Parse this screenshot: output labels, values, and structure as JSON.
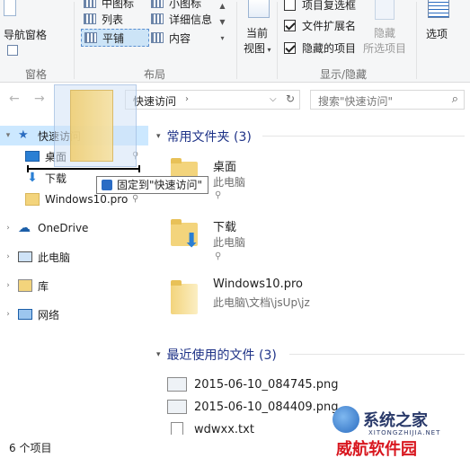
{
  "ribbon": {
    "pane": {
      "nav_pane": "导航窗格",
      "group": "窗格"
    },
    "layout": {
      "group": "布局",
      "items_col1": [
        "中图标",
        "列表",
        "平铺"
      ],
      "items_col2": [
        "小图标",
        "详细信息",
        "内容"
      ],
      "selected": "平铺"
    },
    "current_view": {
      "label_line1": "当前",
      "label_line2": "视图"
    },
    "show_hide": {
      "group": "显示/隐藏",
      "checks": [
        {
          "label": "项目复选框",
          "checked": false
        },
        {
          "label": "文件扩展名",
          "checked": true
        },
        {
          "label": "隐藏的项目",
          "checked": true
        }
      ],
      "hide_line1": "隐藏",
      "hide_line2": "所选项目"
    },
    "options": "选项"
  },
  "address": {
    "path": "快速访问",
    "search_placeholder": "搜索\"快速访问\""
  },
  "nav_tree": {
    "quick_access": "快速访问",
    "items": [
      "桌面",
      "下载",
      "Windows10.pro"
    ],
    "onedrive": "OneDrive",
    "this_pc": "此电脑",
    "library": "库",
    "network": "网络"
  },
  "drag_tooltip": "固定到\"快速访问\"",
  "content": {
    "frequent_header": "常用文件夹 (3)",
    "folders": [
      {
        "name": "桌面",
        "location": "此电脑"
      },
      {
        "name": "下载",
        "location": "此电脑"
      },
      {
        "name": "Windows10.pro",
        "location": "此电脑\\文档\\jsUp\\jz"
      }
    ],
    "recent_header": "最近使用的文件 (3)",
    "files": [
      "2015-06-10_084745.png",
      "2015-06-10_084409.png",
      "wdwxx.txt"
    ]
  },
  "status": {
    "count": "6 个项目"
  },
  "watermark": {
    "title": "系统之家",
    "sub": "XITONGZHIJIA.NET",
    "red": "威航软件园"
  },
  "colors": {
    "accent": "#1e3287",
    "selection": "#cce8ff",
    "folder": "#f3d47c"
  }
}
